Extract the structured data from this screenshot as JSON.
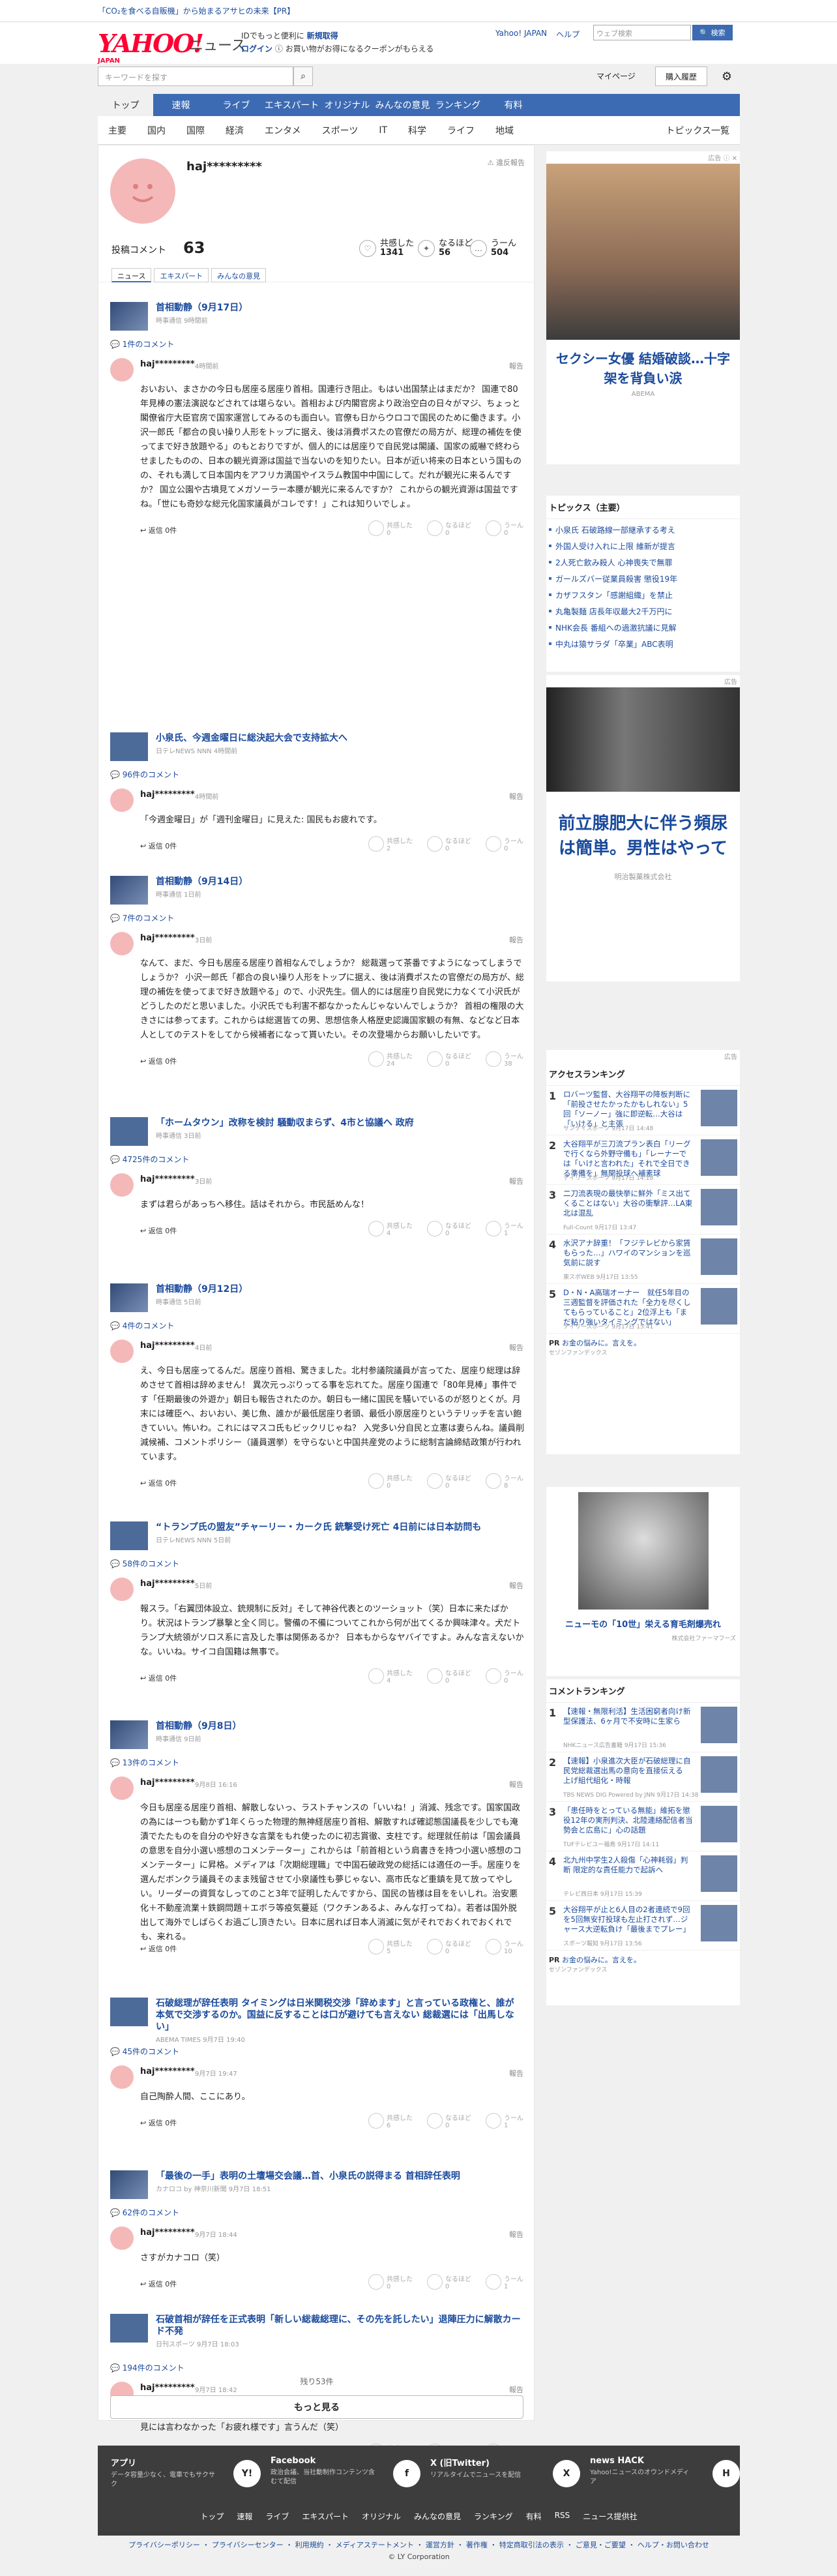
{
  "top_banner": {
    "text": "「CO₂を食べる自販機」から始まるアサヒの未来【PR】"
  },
  "header": {
    "logo": "YAHOO!",
    "logo_sub": "JAPAN",
    "section": "ニュース",
    "promo_line1": "IDでもっと便利に",
    "promo_line1_bold": "新規取得",
    "promo_login": "ログイン",
    "promo_line2": "お買い物がお得になるクーポンがもらえる",
    "links": [
      "Yahoo! JAPAN",
      "ヘルプ"
    ],
    "web_search_placeholder": "ウェブ検索",
    "web_search_button": "🔍 検索"
  },
  "search": {
    "placeholder": "キーワードを探す",
    "mypage": "マイページ",
    "buy": "購入履歴"
  },
  "gnav": [
    "トップ",
    "速報",
    "ライブ",
    "エキスパート",
    "オリジナル",
    "みんなの意見",
    "ランキング",
    "有料"
  ],
  "subnav": [
    "主要",
    "国内",
    "国際",
    "経済",
    "エンタメ",
    "スポーツ",
    "IT",
    "科学",
    "ライフ",
    "地域"
  ],
  "subnav_topics": "トピックス一覧",
  "profile": {
    "username": "haj*********",
    "violation": "違反報告",
    "posts_label": "投稿コメント",
    "posts_count": "63",
    "stats": [
      {
        "label": "共感した",
        "count": "1341"
      },
      {
        "label": "なるほど",
        "count": "56"
      },
      {
        "label": "うーん",
        "count": "504"
      }
    ],
    "tabs": [
      "ニュース",
      "エキスパート",
      "みんなの意見"
    ]
  },
  "feed": [
    {
      "article": "首相動静（9月17日）",
      "source": "時事通信 9時間前",
      "ccount": "1件のコメント",
      "user": "haj*********",
      "time": "4時間前",
      "text": "おいおい、まさかの今日も居座る居座り首相。国連行き阻止。もはい出国禁止はまだか？ 国連で80年見棒の憲法演説などされては堪らない。首相および内閣官房より政治空白の日々がマジ、ちょっと閣僚省庁大臣官房で国家運営してみるのも面白い。官僚も日からウロコで国民のために働きます。小沢一郎氏「都合の良い操り人形をトップに据え、後は消費ポスたの官僚だの局方が、総理の補佐を使ってまで好き放題やる」のもとおりですが、個人的には居座りで自民党は閣議、国家の威嚇で終わらせましたものの、日本の観光資源は国益で当ないのを知りたい。日本が近い将来の日本という国ものの、それも満して日本国内をアフリカ満国やイスラム教国中中国にして。だれが観光に来るんですか？ 国立公園や古墳見てメガソーラー本腰が観光に来るんですか？ これからの観光資源は国益ですね。「世にも奇妙な総元化国家議員がコレです！」これは知りいでしょ。",
      "r": [
        "0",
        "0",
        "0"
      ]
    },
    {
      "article": "小泉氏、今週金曜日に総決起大会で支持拡大へ",
      "source": "日テレNEWS NNN 4時間前",
      "ccount": "96件のコメント",
      "user": "haj*********",
      "time": "4時間前",
      "text": "「今週金曜日」が「週刊金曜日」に見えた: 国民もお疲れです。",
      "r": [
        "2",
        "0",
        "0"
      ]
    },
    {
      "article": "首相動静（9月14日）",
      "source": "時事通信 1日前",
      "ccount": "7件のコメント",
      "user": "haj*********",
      "time": "3日前",
      "text": "なんて、まだ、今日も居座る居座り首相なんでしょうか？ 総裁選って茶番ですようになってしまうでしょうか？ 小沢一郎氏「都合の良い操り人形をトップに据え、後は消費ポスたの官僚だの局方が、総理の補佐を使ってまで好き放題やる」ので、小沢先生。個人的には居座り自民党に力なくて小沢氏がどうしたのだと思いました。小沢氏でも利害不都なかったんじゃないんでしょうか？ 首相の権限の大きさには参ってます。これからは総選皆ての男、思想信条人格歴史認識国家観の有無、などなど日本人としてのテストをしてから候補者になって貰いたい。その次登場からお願いしたいです。",
      "r": [
        "24",
        "0",
        "38"
      ]
    },
    {
      "article": "「ホームタウン」改称を検討 騒動収まらず、4市と協議へ 政府",
      "source": "時事通信 3日前",
      "ccount": "4725件のコメント",
      "user": "haj*********",
      "time": "3日前",
      "text": "まずは君らがあっちへ移住。話はそれから。市民舐めんな！",
      "r": [
        "4",
        "0",
        "1"
      ]
    },
    {
      "article": "首相動静（9月12日）",
      "source": "時事通信 5日前",
      "ccount": "4件のコメント",
      "user": "haj*********",
      "time": "4日前",
      "text": "え、今日も居座ってるんだ。居座り首相、驚きました。北村参議院議員が言ってた、居座り総理は辞めさせて首相は辞めません！ 異次元っぷりってる事を忘れてた。居座り国連で「80年見棒」事件です「任期最後の外遊か」朝日も報告されたのか。朝日も一緒に国民を騒いでいるのが怒りとくが。月末には確臣へ、おいおい、美じ魚、誰かが最低居座り者頭、最低小原居座りというテリッチを言い飽きていい。怖いわ。これにはマスコ氏もビックリじゃね？ 入党多い分自民と立憲は妻らんね。議員削減候補、コメントポリシー（議員選挙）を守らないと中国共産党のように総制言論締結政策が行われています。",
      "r": [
        "0",
        "0",
        "8"
      ]
    },
    {
      "article": "“トランプ氏の盟友”チャーリー・カーク氏 銃撃受け死亡 4日前には日本訪問も",
      "source": "日テレNEWS NNN 5日前",
      "ccount": "58件のコメント",
      "user": "haj*********",
      "time": "5日前",
      "text": "報スラ。「右翼団体設立、銃規制に反対」そして神谷代表とのツーショット（笑）日本に来たばかり。状況はトランプ暴撃と全く同じ。警備の不備についてこれから何が出てくるか興味津々。犬だトランプ大統領がソロス系に言及した事は関係あるか？ 日本もからなヤバイですよ。みんな言えないかな。いいね。サイコ自国籍は無事で。",
      "r": [
        "4",
        "0",
        "0"
      ]
    },
    {
      "article": "首相動静（9月8日）",
      "source": "時事通信 9日前",
      "ccount": "13件のコメント",
      "user": "haj*********",
      "time": "9月8日 16:16",
      "text": "今日も居座る居座り首相、解散しないっ、ラストチャンスの「いいね！」消減、残念です。国家国政の為にはーつも動かず1年くらった物理的無神経居座り首相、解散すれば確認態国議長を少しでも淹漬でたたものを自分のや好きな言葉をもれ使ったのに初志賞徹、支柱です。総理就任前は「国会議員の意思を自分小選い感想のコメンテーター」これからは「前首相という肩書きを持つ小選い感想のコメンテーター」に昇格。メディアは「次期総理職」で中国石破政党の総括には適任の一手。居座りを選んだボンクラ議員そのまま残留させて小泉議性も夢じゃない、高市氏など重鎮を見て放ってやしい。リーダーの資質なしってのこと3年で証明したんですから、国民の皆様は目ををいしれ。治安悪化＋不動産流業＋鉄鋼問題＋エボラ等疫気蔓延（ワクチンあるよ、みんな打ってね）。若者は国外脱出して海外でしばらくお過ごし頂きたい。日本に居れば日本人消滅に気がそれでおくれでおくれでも、来れる。",
      "r": [
        "5",
        "0",
        "10"
      ]
    },
    {
      "article": "石破総理が辞任表明 タイミングは日米関税交渉「辞めます」と言っている政権と、誰が本気で交渉するのか。国益に反することは口が避けても言えない 総裁選には「出馬しない」",
      "source": "ABEMA TIMES 9月7日 19:40",
      "ccount": "45件のコメント",
      "user": "haj*********",
      "time": "9月7日 19:47",
      "text": "自己陶酔人間、ここにあり。",
      "r": [
        "6",
        "0",
        "1"
      ]
    },
    {
      "article": "「最後の一手」表明の土壇場交会議…首、小泉氏の説得まる 首相辞任表明",
      "source": "カナロコ by 神奈川新聞 9月7日 18:51",
      "ccount": "62件のコメント",
      "user": "haj*********",
      "time": "9月7日 18:44",
      "text": "さすがカナコロ（笑）",
      "r": [
        "0",
        "0",
        "1"
      ]
    },
    {
      "article": "石破首相が辞任を正式表明「新しい総裁総理に、その先を託したい」退陣圧力に解散カード不発",
      "source": "日刊スポーツ 9月7日 18:03",
      "ccount": "194件のコメント",
      "user": "haj*********",
      "time": "9月7日 18:42",
      "text": "握座う日今億命、あの態、笑える！ 解散カード不発、次期総理職小泉決定、記者達は安倍総理勝任会見には言わなかった「お疲れ様です」言うんだ（笑）",
      "r": [
        "3",
        "0",
        "0"
      ]
    }
  ],
  "reply_label": "返信 0件",
  "report_label": "報告",
  "more": {
    "remaining": "残り53件",
    "button": "もっと見る"
  },
  "sidebar": {
    "ad_label": "広告",
    "ad1_title": "セクシー女優 結婚破談…十字架を背負い涙",
    "ad1_source": "ABEMA",
    "topics_title": "トピックス（主要）",
    "topics": [
      "小泉氏 石破路線一部継承する考え",
      "外国人受け入れに上限 維新が提言",
      "2人死亡飲み殺人 心神喪失で無罪",
      "ガールズバー従業員殺害 懲役19年",
      "カザフスタン「感謝組織」を禁止",
      "丸亀製麺 店長年収最大2千万円に",
      "NHK会長 番組への過激抗議に見解",
      "中丸は猿サラダ「卒業」ABC表明"
    ],
    "ad2_title": "前立腺肥大に伴う頻尿は簡単。男性はやって",
    "ad2_source": "明治製菓株式会社",
    "access_title": "アクセスランキング",
    "access": [
      {
        "n": "1",
        "t": "ロバーツ監督、大谷翔平の降板判断に「前投させたかったかもしれない」5回「ソーノー」強に即逆転…大谷は「いける」と主張",
        "s": "サンケイスポーツ 9月17日 14:48"
      },
      {
        "n": "2",
        "t": "大谷翔平が三刀流プラン表白「リーグで行くなら外野守備も」「レーナーでは「いけと言われた」それで全日できる準備を」無関投球へ補素球",
        "s": "デイリースポーツ 9月17日 14:18"
      },
      {
        "n": "3",
        "t": "二刀流表現の最快挙に鮮外「ミス出てくることはない」大谷の衝撃評…LA東北は混乱",
        "s": "Full-Count 9月17日 13:47"
      },
      {
        "n": "4",
        "t": "水沢アナ辞重！「フジテレビから家賃もらった…」ハワイのマンションを巡気前に説す",
        "s": "東スポWEB 9月17日 13:55"
      },
      {
        "n": "5",
        "t": "D・N・A高瑞オーナー　就任5年目の三週監督を評価された「全力を尽くしてもらっていること」2位浮上も「まだ粘り強いタイミングではない」",
        "s": "デイリースポーツ 9月17日 15:41"
      }
    ],
    "pr1": "お金の悩みに。言えを。",
    "pr1_sub": "セゾンファンデックス",
    "ad3_title": "ニューモの「10世」栄える育毛剤爆売れ",
    "ad3_source": "株式会社ファーマフーズ",
    "comment_title": "コメントランキング",
    "comments_rank": [
      {
        "n": "1",
        "t": "【速報・無限利活】生活困窮者向け新型保護法、6ヶ月で不安時に生家ら",
        "s": "NHKニュース広告書籍 9月17日 15:36"
      },
      {
        "n": "2",
        "t": "【速報】小泉進次大臣が石破総理に自民党総裁選出馬の意向を直接伝える　上げ組代組化・時報",
        "s": "TBS NEWS DIG Powered by JNN 9月17日 14:38"
      },
      {
        "n": "3",
        "t": "「患任時をとっている無能」維拓を懲役12年の実刑判決、北陸連絡配信者当勢会と広島に」心の話題",
        "s": "TUFテレビユー福島 9月17日 14:11"
      },
      {
        "n": "4",
        "t": "北九州中学生2人殺傷「心神耗弱」判断 限定的な責任能力で起訴へ",
        "s": "テレビ西日本 9月17日 15:39"
      },
      {
        "n": "5",
        "t": "大谷翔平が止と6人目の2者連続で9回を5回無安打投球も左止打されず…ジャース大逆転負け「最後までプレー」",
        "s": "スポーツ報知 9月17日 13:56"
      }
    ],
    "pr2": "お金の悩みに。言えを。",
    "pr2_sub": "セゾンファンデックス"
  },
  "footer": {
    "apps": [
      {
        "t": "アプリ",
        "d": "データ容量少なく、電車でもサクサク",
        "ic": "Y!"
      },
      {
        "t": "Facebook",
        "d": "政治会議、当社動制作コンテンツ含むて配信",
        "ic": "f"
      },
      {
        "t": "X (旧Twitter)",
        "d": "リアルタイムでニュースを配信",
        "ic": "X"
      },
      {
        "t": "news HACK",
        "d": "Yahoo!ニュースのオウンドメディア",
        "ic": "H"
      }
    ],
    "nav": [
      "トップ",
      "速報",
      "ライブ",
      "エキスパート",
      "オリジナル",
      "みんなの意見",
      "ランキング",
      "有料",
      "RSS",
      "ニュース提供社"
    ],
    "legal": "プライバシーポリシー ・ プライバシーセンター ・ 利用規約 ・ メディアステートメント ・ 運営方針 ・ 著作権 ・ 特定商取引法の表示 ・ ご意見・ご要望 ・ ヘルプ・お問い合わせ",
    "copyright": "© LY Corporation"
  },
  "colors": {
    "brand": "#ff0033",
    "nav": "#3d6bb3",
    "link": "#1a4a9c"
  }
}
